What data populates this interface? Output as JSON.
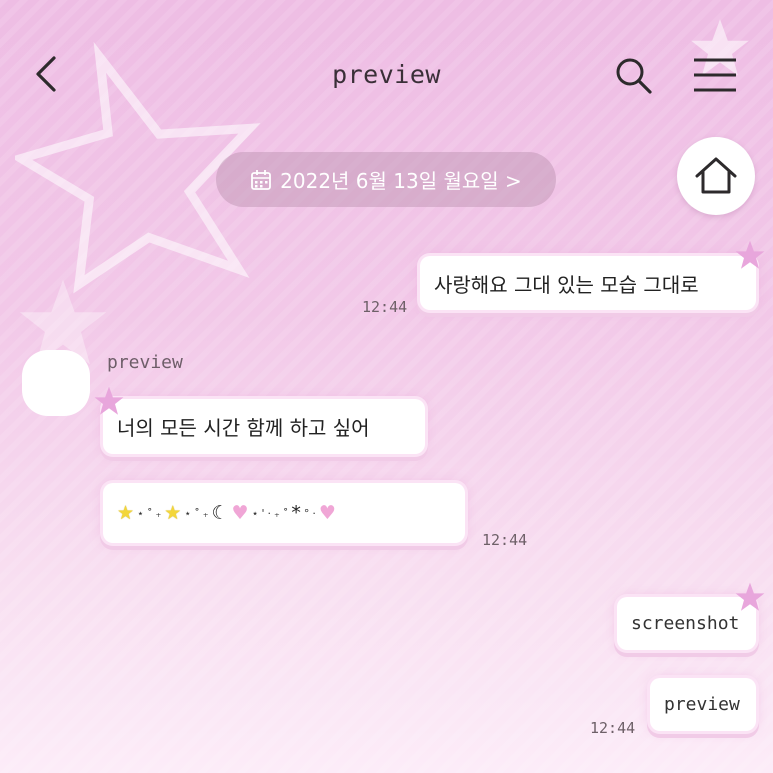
{
  "header": {
    "title": "preview",
    "back_icon": "chevron-left-icon",
    "search_icon": "search-icon",
    "menu_icon": "hamburger-menu-icon"
  },
  "date_bar": {
    "label": "2022년 6월 13일 월요일 >",
    "icon": "calendar-icon"
  },
  "home_button": {
    "icon": "home-icon"
  },
  "messages": [
    {
      "direction": "outgoing",
      "text": "사랑해요 그대 있는 모습 그대로",
      "time": "12:44"
    },
    {
      "direction": "incoming",
      "sender": "preview",
      "text": "너의 모든 시간 함께 하고 싶어"
    },
    {
      "direction": "incoming",
      "time": "12:44",
      "emoji": [
        "★",
        "⋆",
        "˚",
        "₊",
        "★",
        "⋆",
        "˚",
        "₊",
        "☾",
        "♥",
        "⋆",
        "'",
        "·",
        "₊",
        "˚",
        "*",
        "°",
        "·",
        "♥"
      ]
    },
    {
      "direction": "outgoing",
      "text": "screenshot"
    },
    {
      "direction": "outgoing",
      "text": "preview",
      "time": "12:44"
    }
  ],
  "colors": {
    "background_top": "#eebde4",
    "background_bottom": "#fcecf8",
    "bubble": "#ffffff",
    "accent_star": "#e8a6dc",
    "date_pill": "#b48caa"
  }
}
